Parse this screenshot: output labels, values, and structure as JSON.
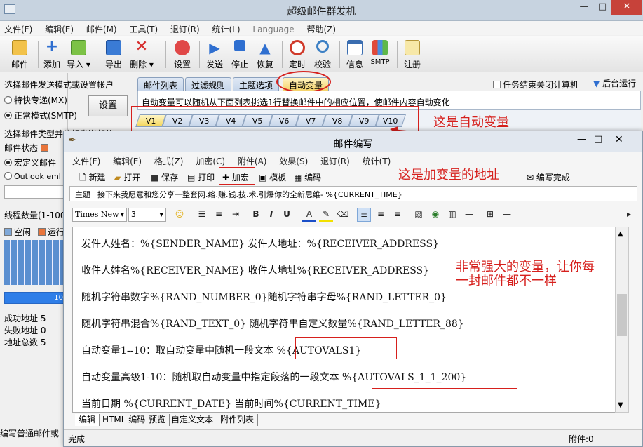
{
  "app": {
    "title": "超级邮件群发机",
    "window_buttons": {
      "minimize": "—",
      "maximize": "□",
      "close": "✕"
    }
  },
  "menu": [
    "文件(F)",
    "编辑(E)",
    "邮件(M)",
    "工具(T)",
    "退订(R)",
    "统计(L)",
    "Language",
    "帮助(Z)"
  ],
  "toolbar": [
    {
      "label": "邮件",
      "icon": "mail-icon"
    },
    {
      "label": "添加",
      "icon": "add-icon"
    },
    {
      "label": "导入",
      "icon": "import-icon"
    },
    {
      "label": "导出",
      "icon": "export-icon"
    },
    {
      "label": "删除",
      "icon": "delete-icon"
    },
    {
      "label": "设置",
      "icon": "settings-icon"
    },
    {
      "label": "发送",
      "icon": "send-icon"
    },
    {
      "label": "停止",
      "icon": "stop-icon"
    },
    {
      "label": "恢复",
      "icon": "resume-icon"
    },
    {
      "label": "定时",
      "icon": "timer-icon"
    },
    {
      "label": "校验",
      "icon": "verify-icon"
    },
    {
      "label": "信息",
      "icon": "info-icon"
    },
    {
      "label": "SMTP",
      "icon": "smtp-icon"
    },
    {
      "label": "注册",
      "icon": "register-icon"
    }
  ],
  "left": {
    "mode_prompt": "选择邮件发送模式或设置帐户",
    "mode_special": "特快专递(MX)",
    "mode_normal": "正常模式(SMTP)",
    "settings_button": "设置",
    "type_prompt": "选择邮件类型并编辑发送邮件",
    "mail_status": "邮件状态",
    "custom_mail": "宏定义邮件",
    "outlook": "Outlook eml",
    "thread_count": "线程数量(1-100)",
    "idle": "空闲",
    "running": "运行",
    "progress_label": "10",
    "stats": [
      {
        "label": "成功地址",
        "value": "5"
      },
      {
        "label": "失败地址",
        "value": "0"
      },
      {
        "label": "地址总数",
        "value": "5"
      }
    ],
    "bottom_text": "编写普通邮件或"
  },
  "main": {
    "tabs": [
      "邮件列表",
      "过滤规则",
      "主题选项",
      "自动变量"
    ],
    "shutdown_checkbox": "任务结束关闭计算机",
    "background_run": "后台运行",
    "description": "自动变量可以随机从下面列表挑选1行替换邮件中的相应位置，使邮件内容自动变化",
    "vtabs": [
      "V1",
      "V2",
      "V3",
      "V4",
      "V5",
      "V6",
      "V7",
      "V8",
      "V9",
      "V10"
    ]
  },
  "annotations": {
    "auto_var": "这是自动变量",
    "add_var": "这是加变量的地址",
    "powerful_1": "非常强大的变量，让你每",
    "powerful_2": "一封邮件都不一样"
  },
  "dialog": {
    "title": "邮件编写",
    "menu": [
      "文件(F)",
      "编辑(E)",
      "格式(Z)",
      "加密(C)",
      "附件(A)",
      "效果(S)",
      "退订(R)",
      "统计(T)"
    ],
    "toolbar": [
      "新建",
      "打开",
      "保存",
      "打印",
      "加宏",
      "模板",
      "编码",
      "编写完成"
    ],
    "subject_label": "主题",
    "subject_value": "接下来我愿意和您分享一整套网.络.赚.钱.技.术.引爆你的全新思维- %{CURRENT_TIME}",
    "font_name": "Times New",
    "font_size": "3",
    "format_buttons": [
      "B",
      "I",
      "U"
    ],
    "content_lines": [
      "发件人姓名：%{SENDER_NAME} 发件人地址：%{RECEIVER_ADDRESS}",
      "收件人姓名%{RECEIVER_NAME} 收件人地址%{RECEIVER_ADDRESS}",
      "随机字符串数字%{RAND_NUMBER_0}随机字符串字母%{RAND_LETTER_0}",
      "随机字符串混合%{RAND_TEXT_0} 随机字符串自定义数量%{RAND_LETTER_88}",
      "自动变量1--10：取自动变量中随机一段文本 %{AUTOVALS1}",
      "自动变量高级1-10：随机取自动变量中指定段落的一段文本 %{AUTOVALS_1_1_200}",
      "当前日期 %{CURRENT_DATE}  当前时间%{CURRENT_TIME}"
    ],
    "bottom_tabs": [
      "编辑",
      "HTML 编码",
      "预览",
      "自定义文本",
      "附件列表"
    ]
  },
  "status": {
    "left": "完成",
    "right": "附件:0"
  },
  "colors": {
    "accent_red": "#d6201d",
    "tab_blue": "#c6d5ea",
    "highlight_tab": "#f5d36a"
  }
}
